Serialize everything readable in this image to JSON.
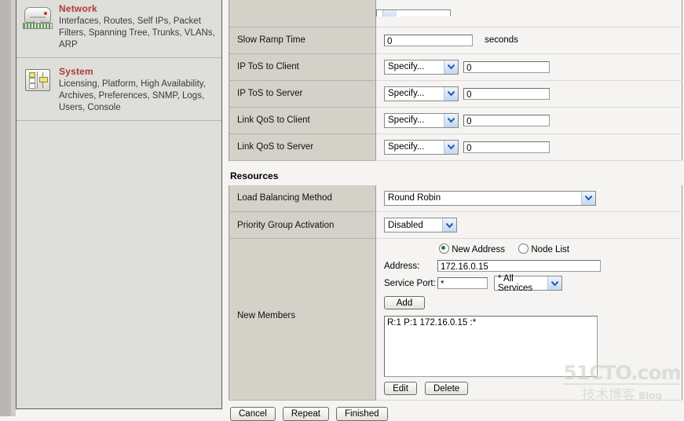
{
  "sidebar": {
    "sections": [
      {
        "icon": "network-appliance-icon",
        "title": "Network",
        "links": "Interfaces, Routes, Self IPs, Packet Filters, Spanning Tree, Trunks, VLANs, ARP"
      },
      {
        "icon": "system-panel-icon",
        "title": "System",
        "links": "Licensing, Platform, High Availability, Archives, Preferences, SNMP, Logs, Users, Console"
      }
    ]
  },
  "form": {
    "rows": [
      {
        "label": "Slow Ramp Time",
        "value": "0",
        "suffix": "seconds"
      },
      {
        "label": "IP ToS to Client",
        "select": "Specify...",
        "value": "0"
      },
      {
        "label": "IP ToS to Server",
        "select": "Specify...",
        "value": "0"
      },
      {
        "label": "Link QoS to Client",
        "select": "Specify...",
        "value": "0"
      },
      {
        "label": "Link QoS to Server",
        "select": "Specify...",
        "value": "0"
      }
    ]
  },
  "resources": {
    "title": "Resources",
    "load_balancing_label": "Load Balancing Method",
    "load_balancing_value": "Round Robin",
    "priority_group_label": "Priority Group Activation",
    "priority_group_value": "Disabled",
    "new_members_label": "New Members",
    "radio_new_address": "New Address",
    "radio_node_list": "Node List",
    "address_label": "Address:",
    "address_value": "172.16.0.15",
    "service_port_label": "Service Port:",
    "service_port_value": "*",
    "service_select_value": "* All Services",
    "add_label": "Add",
    "member_entry": "R:1 P:1 172.16.0.15 :*",
    "edit_label": "Edit",
    "delete_label": "Delete"
  },
  "footer": {
    "cancel_label": "Cancel",
    "repeat_label": "Repeat",
    "finished_label": "Finished"
  },
  "watermark": {
    "line1": "51CTO.com",
    "line2": "技术博客",
    "blog": "Blog"
  },
  "colors": {
    "accent_red": "#b03a36",
    "label_gray": "#d4d1c9",
    "page_bg": "#f5f4f2",
    "sidebar_bg": "#dededa"
  }
}
